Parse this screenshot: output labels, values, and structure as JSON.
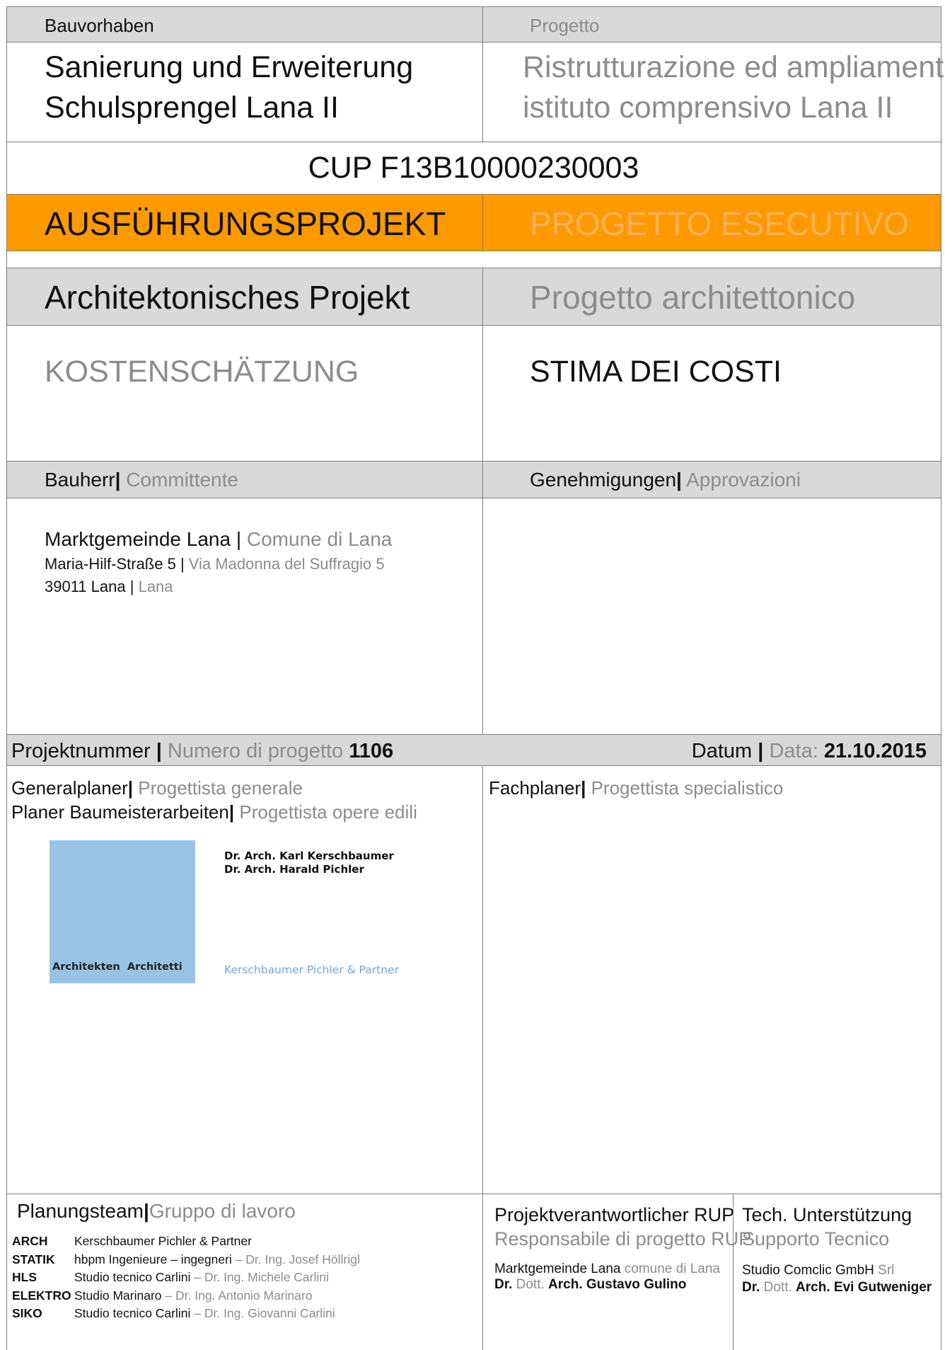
{
  "header": {
    "bauvorhaben": "Bauvorhaben",
    "progetto": "Progetto"
  },
  "title": {
    "de_line1": "Sanierung und Erweiterung",
    "de_line2": "Schulsprengel Lana II",
    "it_line1": "Ristrutturazione ed ampliamento",
    "it_line2": "istituto comprensivo Lana II"
  },
  "cup": "CUP F13B10000230003",
  "phase": {
    "de": "AUSFÜHRUNGSPROJEKT",
    "it": "PROGETTO ESECUTIVO"
  },
  "discipline": {
    "de": "Architektonisches Projekt",
    "it": "Progetto architettonico"
  },
  "document": {
    "de": "KOSTENSCHÄTZUNG",
    "it": "STIMA DEI COSTI"
  },
  "client_header": {
    "de": "Bauherr",
    "sep": "|",
    "it": "Committente",
    "approvals_de": "Genehmigungen",
    "approvals_it": "Approvazioni"
  },
  "client": {
    "name_de": "Marktgemeinde Lana",
    "sep": "|",
    "name_it": "Comune di Lana",
    "street_de": "Maria-Hilf-Straße 5",
    "street_it": "Via Madonna del Suffragio 5",
    "city_de": "39011 Lana",
    "city_it": "Lana"
  },
  "project_number": {
    "label_de": "Projektnummer",
    "sep": "|",
    "label_it": "Numero di progetto",
    "value": "1106",
    "date_label_de": "Datum",
    "date_label_it": "Data:",
    "date_value": "21.10.2015"
  },
  "planners": {
    "general_de": "Generalplaner",
    "general_it": "Progettista generale",
    "building_de": "Planer Baumeisterarbeiten",
    "building_it": "Progettista opere edili",
    "specialist_de": "Fachplaner",
    "specialist_it": "Progettista specialistico",
    "sep": "|"
  },
  "logo": {
    "name1": "Dr. Arch. Karl Kerschbaumer",
    "name2": "Dr. Arch. Harald Pichler",
    "box_text": "Architekten  Architetti",
    "firm": "Kerschbaumer Pichler & Partner",
    "box_color": "#98c3e5",
    "firm_color": "#6fa8d6"
  },
  "team": {
    "title_de": "Planungsteam",
    "sep": "|",
    "title_it": "Gruppo di lavoro",
    "rows": [
      {
        "code": "ARCH",
        "main": "Kerschbaumer Pichler & Partner",
        "extra": ""
      },
      {
        "code": "STATIK",
        "main": "hbpm Ingenieure – ingegneri",
        "extra": " – Dr. Ing. Josef Höllrigl"
      },
      {
        "code": "HLS",
        "main": "Studio tecnico Carlini",
        "extra": " – Dr. Ing. Michele Carlini"
      },
      {
        "code": "ELEKTRO",
        "main": "Studio Marinaro",
        "extra": " – Dr. Ing. Antonio Marinaro"
      },
      {
        "code": "SIKO",
        "main": "Studio tecnico Carlini",
        "extra": " – Dr. Ing. Giovanni Carlini"
      }
    ]
  },
  "rup": {
    "title_de": "Projektverantwortlicher RUP",
    "title_it": "Responsabile di progetto RUP",
    "org_de": "Marktgemeinde Lana",
    "org_it": "comune di Lana",
    "dr": "Dr.",
    "dott": "Dott.",
    "name": "Arch. Gustavo Gulino"
  },
  "tech": {
    "title_de": "Tech. Unterstützung",
    "title_it": "Supporto Tecnico",
    "org_de": "Studio Comclic GmbH",
    "org_it": "Srl",
    "dr": "Dr.",
    "dott": "Dott.",
    "name": "Arch. Evi Gutweniger"
  },
  "colors": {
    "header_gray": "#d9d9d9",
    "phase_orange": "#ff9900",
    "muted_text": "#8c8c8c",
    "border": "#7f7f7f"
  }
}
